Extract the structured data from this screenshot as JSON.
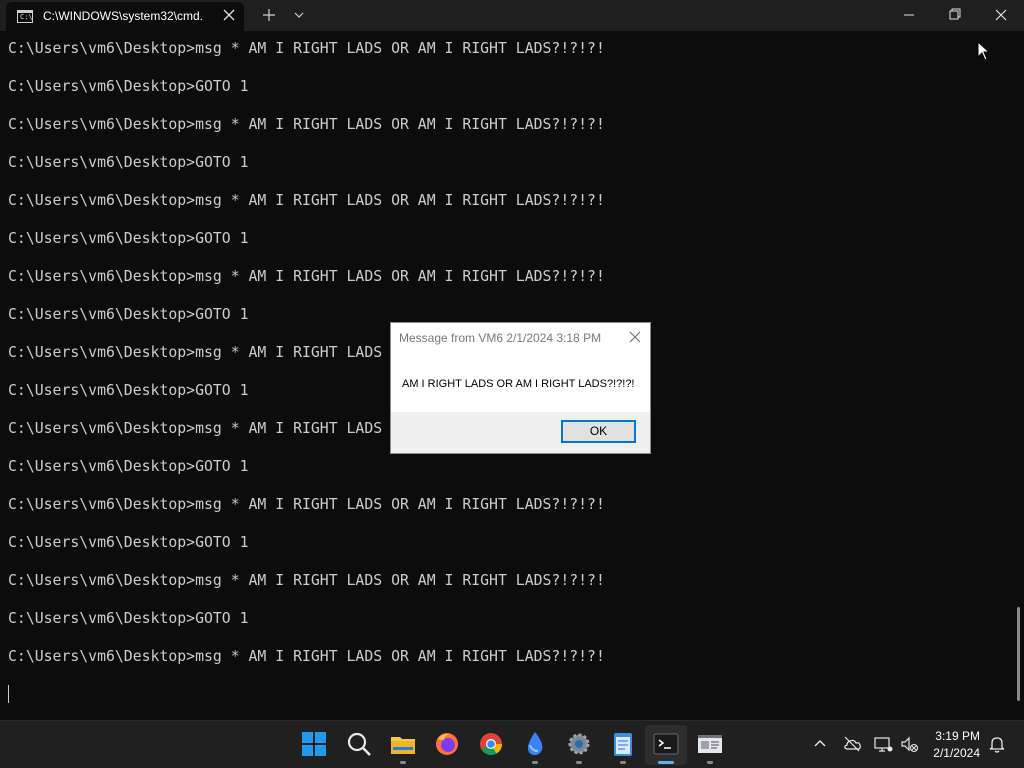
{
  "titlebar": {
    "tab_title": "C:\\WINDOWS\\system32\\cmd.",
    "tab_icon": "cmd-icon",
    "cmd_icon_glyph": "C:\\"
  },
  "terminal": {
    "lines": [
      "C:\\Users\\vm6\\Desktop>msg * AM I RIGHT LADS OR AM I RIGHT LADS?!?!?!",
      "C:\\Users\\vm6\\Desktop>GOTO 1",
      "C:\\Users\\vm6\\Desktop>msg * AM I RIGHT LADS OR AM I RIGHT LADS?!?!?!",
      "C:\\Users\\vm6\\Desktop>GOTO 1",
      "C:\\Users\\vm6\\Desktop>msg * AM I RIGHT LADS OR AM I RIGHT LADS?!?!?!",
      "C:\\Users\\vm6\\Desktop>GOTO 1",
      "C:\\Users\\vm6\\Desktop>msg * AM I RIGHT LADS OR AM I RIGHT LADS?!?!?!",
      "C:\\Users\\vm6\\Desktop>GOTO 1",
      "C:\\Users\\vm6\\Desktop>msg * AM I RIGHT LADS",
      "C:\\Users\\vm6\\Desktop>GOTO 1",
      "C:\\Users\\vm6\\Desktop>msg * AM I RIGHT LADS",
      "C:\\Users\\vm6\\Desktop>GOTO 1",
      "C:\\Users\\vm6\\Desktop>msg * AM I RIGHT LADS OR AM I RIGHT LADS?!?!?!",
      "C:\\Users\\vm6\\Desktop>GOTO 1",
      "C:\\Users\\vm6\\Desktop>msg * AM I RIGHT LADS OR AM I RIGHT LADS?!?!?!",
      "C:\\Users\\vm6\\Desktop>GOTO 1",
      "C:\\Users\\vm6\\Desktop>msg * AM I RIGHT LADS OR AM I RIGHT LADS?!?!?!"
    ]
  },
  "dialog": {
    "title": "Message from VM6 2/1/2024 3:18 PM",
    "message": "AM I RIGHT LADS OR AM I RIGHT LADS?!?!?!",
    "ok_label": "OK"
  },
  "taskbar": {
    "apps": [
      {
        "icon": "windows-start-icon"
      },
      {
        "icon": "search-icon"
      },
      {
        "icon": "file-explorer-icon"
      },
      {
        "icon": "firefox-icon"
      },
      {
        "icon": "chrome-icon"
      },
      {
        "icon": "droplet-app-icon"
      },
      {
        "icon": "settings-gear-icon"
      },
      {
        "icon": "notepad-icon"
      },
      {
        "icon": "terminal-icon"
      },
      {
        "icon": "remote-desktop-icon"
      }
    ],
    "tray": [
      "chevron-up-icon",
      "onedrive-offline-icon",
      "network-icon",
      "volume-muted-icon"
    ],
    "clock_time": "3:19 PM",
    "clock_date": "2/1/2024",
    "notification_icon": "bell-icon",
    "colors": {
      "accent": "#5fb2f2",
      "windows_blue": "#0078d4"
    }
  }
}
